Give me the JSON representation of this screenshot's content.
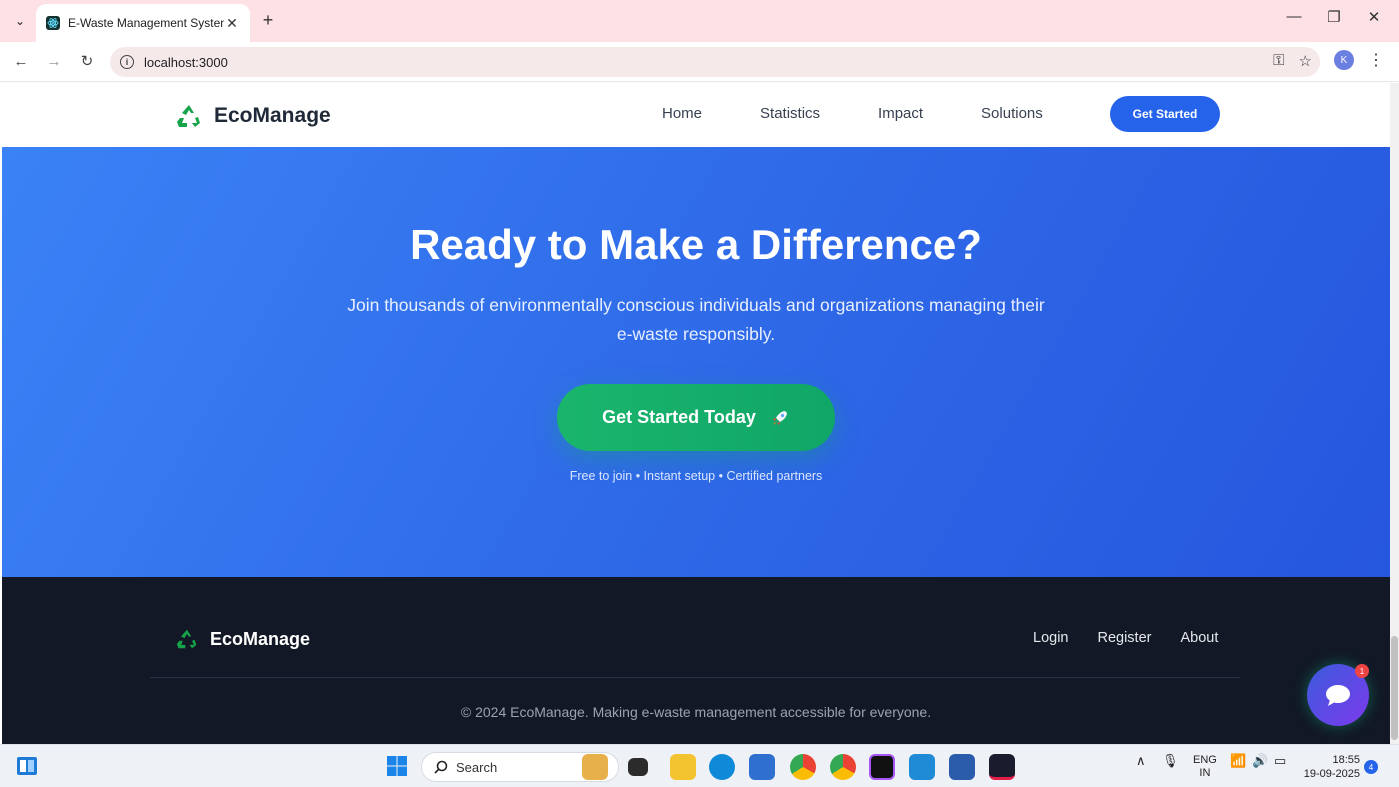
{
  "browser": {
    "tab_title": "E-Waste Management System",
    "url": "localhost:3000",
    "profile_initial": "K"
  },
  "nav": {
    "brand": "EcoManage",
    "links": [
      "Home",
      "Statistics",
      "Impact",
      "Solutions"
    ],
    "cta": "Get Started"
  },
  "hero": {
    "title": "Ready to Make a Difference?",
    "subtitle": "Join thousands of environmentally conscious individuals and organizations managing their e-waste responsibly.",
    "cta": "Get Started Today",
    "note": "Free to join • Instant setup • Certified partners"
  },
  "footer": {
    "brand": "EcoManage",
    "links": [
      "Login",
      "Register",
      "About"
    ],
    "copyright": "© 2024 EcoManage. Making e-waste management accessible for everyone."
  },
  "chat": {
    "badge": "1"
  },
  "taskbar": {
    "search_placeholder": "Search",
    "lang_line1": "ENG",
    "lang_line2": "IN",
    "time": "18:55",
    "date": "19-09-2025",
    "notifications": "4"
  },
  "colors": {
    "primary": "#2563eb",
    "accent_green": "#10a667",
    "footer_bg": "#121826",
    "tabbar_bg": "#fde1e4"
  }
}
